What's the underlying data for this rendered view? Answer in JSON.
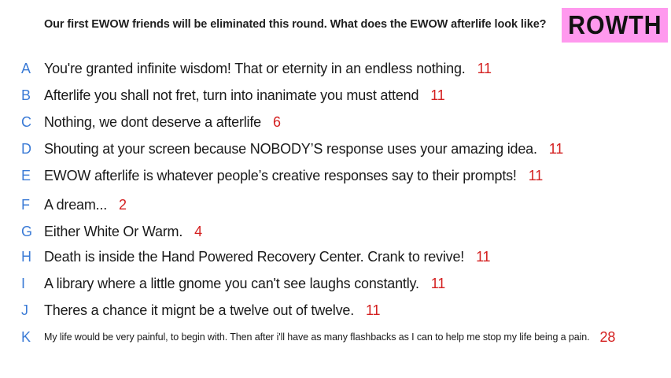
{
  "prompt": "Our first EWOW friends will be eliminated this round. What does the EWOW afterlife look like?",
  "badge": "ROWTH",
  "responses": [
    {
      "letter": "A",
      "text": "You're granted infinite wisdom! That or eternity in an endless nothing.",
      "count": "11"
    },
    {
      "letter": "B",
      "text": "Afterlife you shall not fret, turn into inanimate you must attend",
      "count": "11"
    },
    {
      "letter": "C",
      "text": "Nothing, we dont deserve a afterlife",
      "count": "6"
    },
    {
      "letter": "D",
      "text": "Shouting at your screen because NOBODY’S response uses your amazing idea.",
      "count": "11"
    },
    {
      "letter": "E",
      "text": "EWOW afterlife is whatever people’s creative responses say to their prompts!",
      "count": "11"
    },
    {
      "letter": "F",
      "text": "A dream...",
      "count": "2"
    },
    {
      "letter": "G",
      "text": "Either White Or Warm.",
      "count": "4"
    },
    {
      "letter": "H",
      "text": "Death is inside the Hand Powered Recovery Center. Crank to revive!",
      "count": "11"
    },
    {
      "letter": "I",
      "text": "A library where a little gnome you can't see laughs constantly.",
      "count": "11"
    },
    {
      "letter": "J",
      "text": "Theres a chance it mignt be a twelve out of twelve.",
      "count": "11"
    },
    {
      "letter": "K",
      "text": "My life would be very painful, to begin with. Then after i'll have as many flashbacks as I can to help me stop my life being a pain.",
      "count": "28"
    }
  ]
}
